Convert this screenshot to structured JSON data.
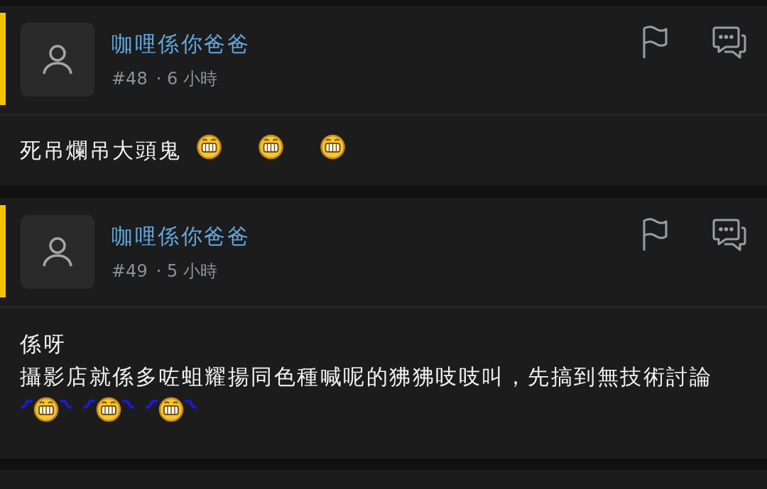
{
  "posts": [
    {
      "author": "咖哩係你爸爸",
      "number": "#48",
      "time": "· 6 小時",
      "highlighted": true,
      "lines": [
        [
          {
            "kind": "text",
            "text": "死吊爛吊大頭鬼"
          },
          {
            "kind": "grin"
          },
          {
            "kind": "grin"
          },
          {
            "kind": "grin"
          }
        ]
      ]
    },
    {
      "author": "咖哩係你爸爸",
      "number": "#49",
      "time": "· 5 小時",
      "highlighted": true,
      "lines": [
        [
          {
            "kind": "text",
            "text": "係呀"
          }
        ],
        [
          {
            "kind": "text",
            "text": "攝影店就係多咗蛆耀揚同色種喊呢的狒狒吱吱叫，先搞到無技術討論"
          }
        ],
        [
          {
            "kind": "dance"
          },
          {
            "kind": "dance"
          },
          {
            "kind": "dance"
          }
        ]
      ]
    }
  ]
}
